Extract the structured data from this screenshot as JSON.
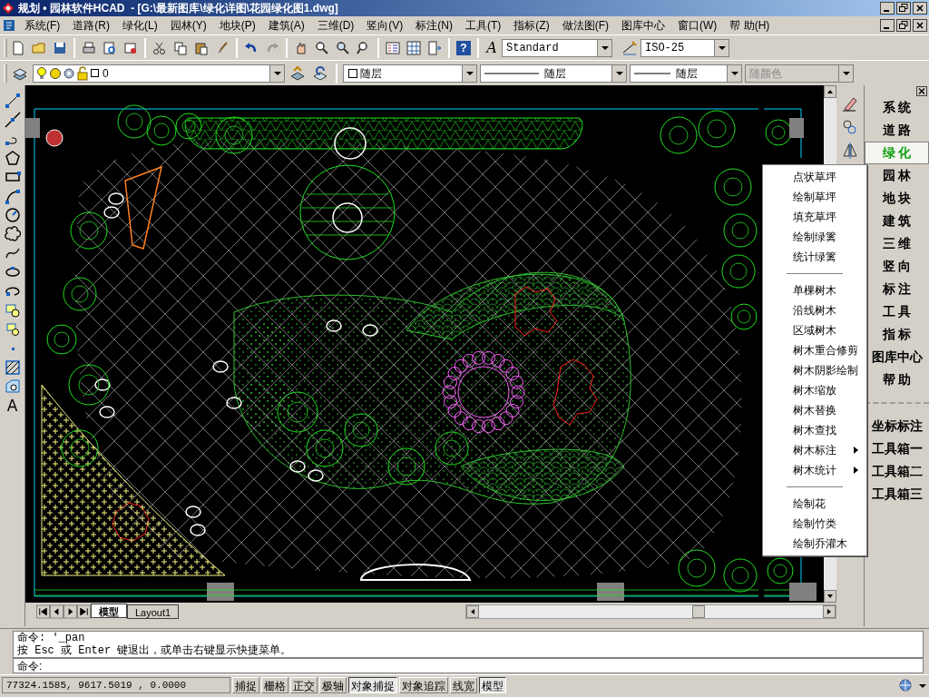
{
  "window": {
    "title": "规划 • 园林软件HCAD  - [G:\\最新图库\\绿化详图\\花园绿化图1.dwg]"
  },
  "menu_bar": [
    "系统(F)",
    "道路(R)",
    "绿化(L)",
    "园林(Y)",
    "地块(P)",
    "建筑(A)",
    "三维(D)",
    "竖向(V)",
    "标注(N)",
    "工具(T)",
    "指标(Z)",
    "做法图(F)",
    "图库中心",
    "窗口(W)",
    "帮 助(H)"
  ],
  "toolbar": {
    "help_glyph": "?",
    "text_style_glyph": "A",
    "text_style": "Standard",
    "dim_style": "ISO-25"
  },
  "draw_toolbar": {
    "text_glyph": "A"
  },
  "properties_bar": {
    "layer": "0",
    "object_colour": "随层",
    "linetype": "随层",
    "lineweight": "随层",
    "plot_style": {
      "value": "随颜色",
      "disabled": true
    }
  },
  "layout_tabs": [
    {
      "label": "模型",
      "selected": true
    },
    {
      "label": "Layout1",
      "selected": false
    }
  ],
  "context_menu": [
    {
      "kind": "item",
      "label": "点状草坪"
    },
    {
      "kind": "item",
      "label": "绘制草坪"
    },
    {
      "kind": "item",
      "label": "填充草坪"
    },
    {
      "kind": "item",
      "label": "绘制绿篱"
    },
    {
      "kind": "item",
      "label": "统计绿篱"
    },
    {
      "kind": "separator"
    },
    {
      "kind": "item",
      "label": "单棵树木"
    },
    {
      "kind": "item",
      "label": "沿线树木"
    },
    {
      "kind": "item",
      "label": "区域树木"
    },
    {
      "kind": "item",
      "label": "树木重合修剪"
    },
    {
      "kind": "item",
      "label": "树木阴影绘制"
    },
    {
      "kind": "item",
      "label": "树木缩放"
    },
    {
      "kind": "item",
      "label": "树木替换"
    },
    {
      "kind": "item",
      "label": "树木查找"
    },
    {
      "kind": "submenu",
      "label": "树木标注"
    },
    {
      "kind": "submenu",
      "label": "树木统计"
    },
    {
      "kind": "separator"
    },
    {
      "kind": "item",
      "label": "绘制花"
    },
    {
      "kind": "item",
      "label": "绘制竹类"
    },
    {
      "kind": "item",
      "label": "绘制乔灌木"
    }
  ],
  "side_panel": {
    "items": [
      {
        "label": "系 统",
        "selected": false
      },
      {
        "label": "道 路",
        "selected": false
      },
      {
        "label": "绿 化",
        "selected": true
      },
      {
        "label": "园 林",
        "selected": false
      },
      {
        "label": "地 块",
        "selected": false
      },
      {
        "label": "建 筑",
        "selected": false
      },
      {
        "label": "三 维",
        "selected": false
      },
      {
        "label": "竖 向",
        "selected": false
      },
      {
        "label": "标 注",
        "selected": false
      },
      {
        "label": "工 具",
        "selected": false
      },
      {
        "label": "指 标",
        "selected": false
      },
      {
        "label": "图库中心",
        "selected": false
      },
      {
        "label": "帮 助",
        "selected": false
      }
    ],
    "tools": [
      "坐标标注",
      "工具箱一",
      "工具箱二",
      "工具箱三"
    ]
  },
  "command": {
    "history": [
      "命令: '_pan",
      "按 Esc 或 Enter 键退出，或单击右键显示快捷菜单。"
    ],
    "prompt": "命令:"
  },
  "status_bar": {
    "coordinates": "77324.1585, 9617.5019 , 0.0000",
    "toggles": [
      {
        "label": "捕捉",
        "on": false
      },
      {
        "label": "栅格",
        "on": false
      },
      {
        "label": "正交",
        "on": false
      },
      {
        "label": "极轴",
        "on": false
      },
      {
        "label": "对象捕捉",
        "on": true
      },
      {
        "label": "对象追踪",
        "on": false
      },
      {
        "label": "线宽",
        "on": false
      },
      {
        "label": "模型",
        "on": true
      }
    ]
  }
}
